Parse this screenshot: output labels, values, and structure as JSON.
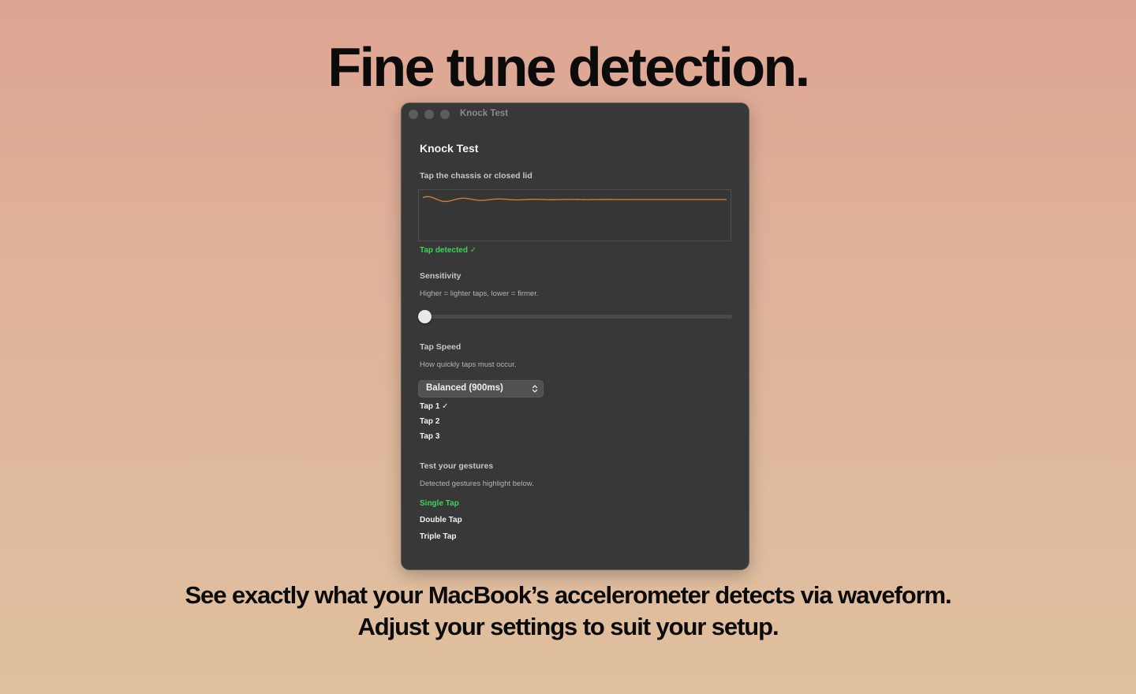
{
  "headline": "Fine tune detection.",
  "window": {
    "title": "Knock Test",
    "heading": "Knock Test",
    "tap_prompt": "Tap the chassis or closed lid",
    "tap_status": "Tap detected ✓",
    "sensitivity": {
      "label": "Sensitivity",
      "hint": "Higher = lighter taps, lower = firmer.",
      "value": 0
    },
    "tap_speed": {
      "label": "Tap Speed",
      "hint": "How quickly taps must occur.",
      "selected": "Balanced (900ms)",
      "taps": [
        "Tap 1 ✓",
        "Tap 2",
        "Tap 3"
      ]
    },
    "gestures": {
      "label": "Test your gestures",
      "hint": "Detected gestures highlight below.",
      "items": [
        "Single Tap",
        "Double Tap",
        "Triple Tap"
      ],
      "highlighted": "Single Tap"
    }
  },
  "caption_lines": [
    "See exactly what your MacBook’s accelerometer detects via waveform.",
    "Adjust your settings to suit your setup."
  ],
  "colors": {
    "accent_green": "#3fd25b",
    "waveform": "#d9822b",
    "window_bg": "#383838"
  }
}
